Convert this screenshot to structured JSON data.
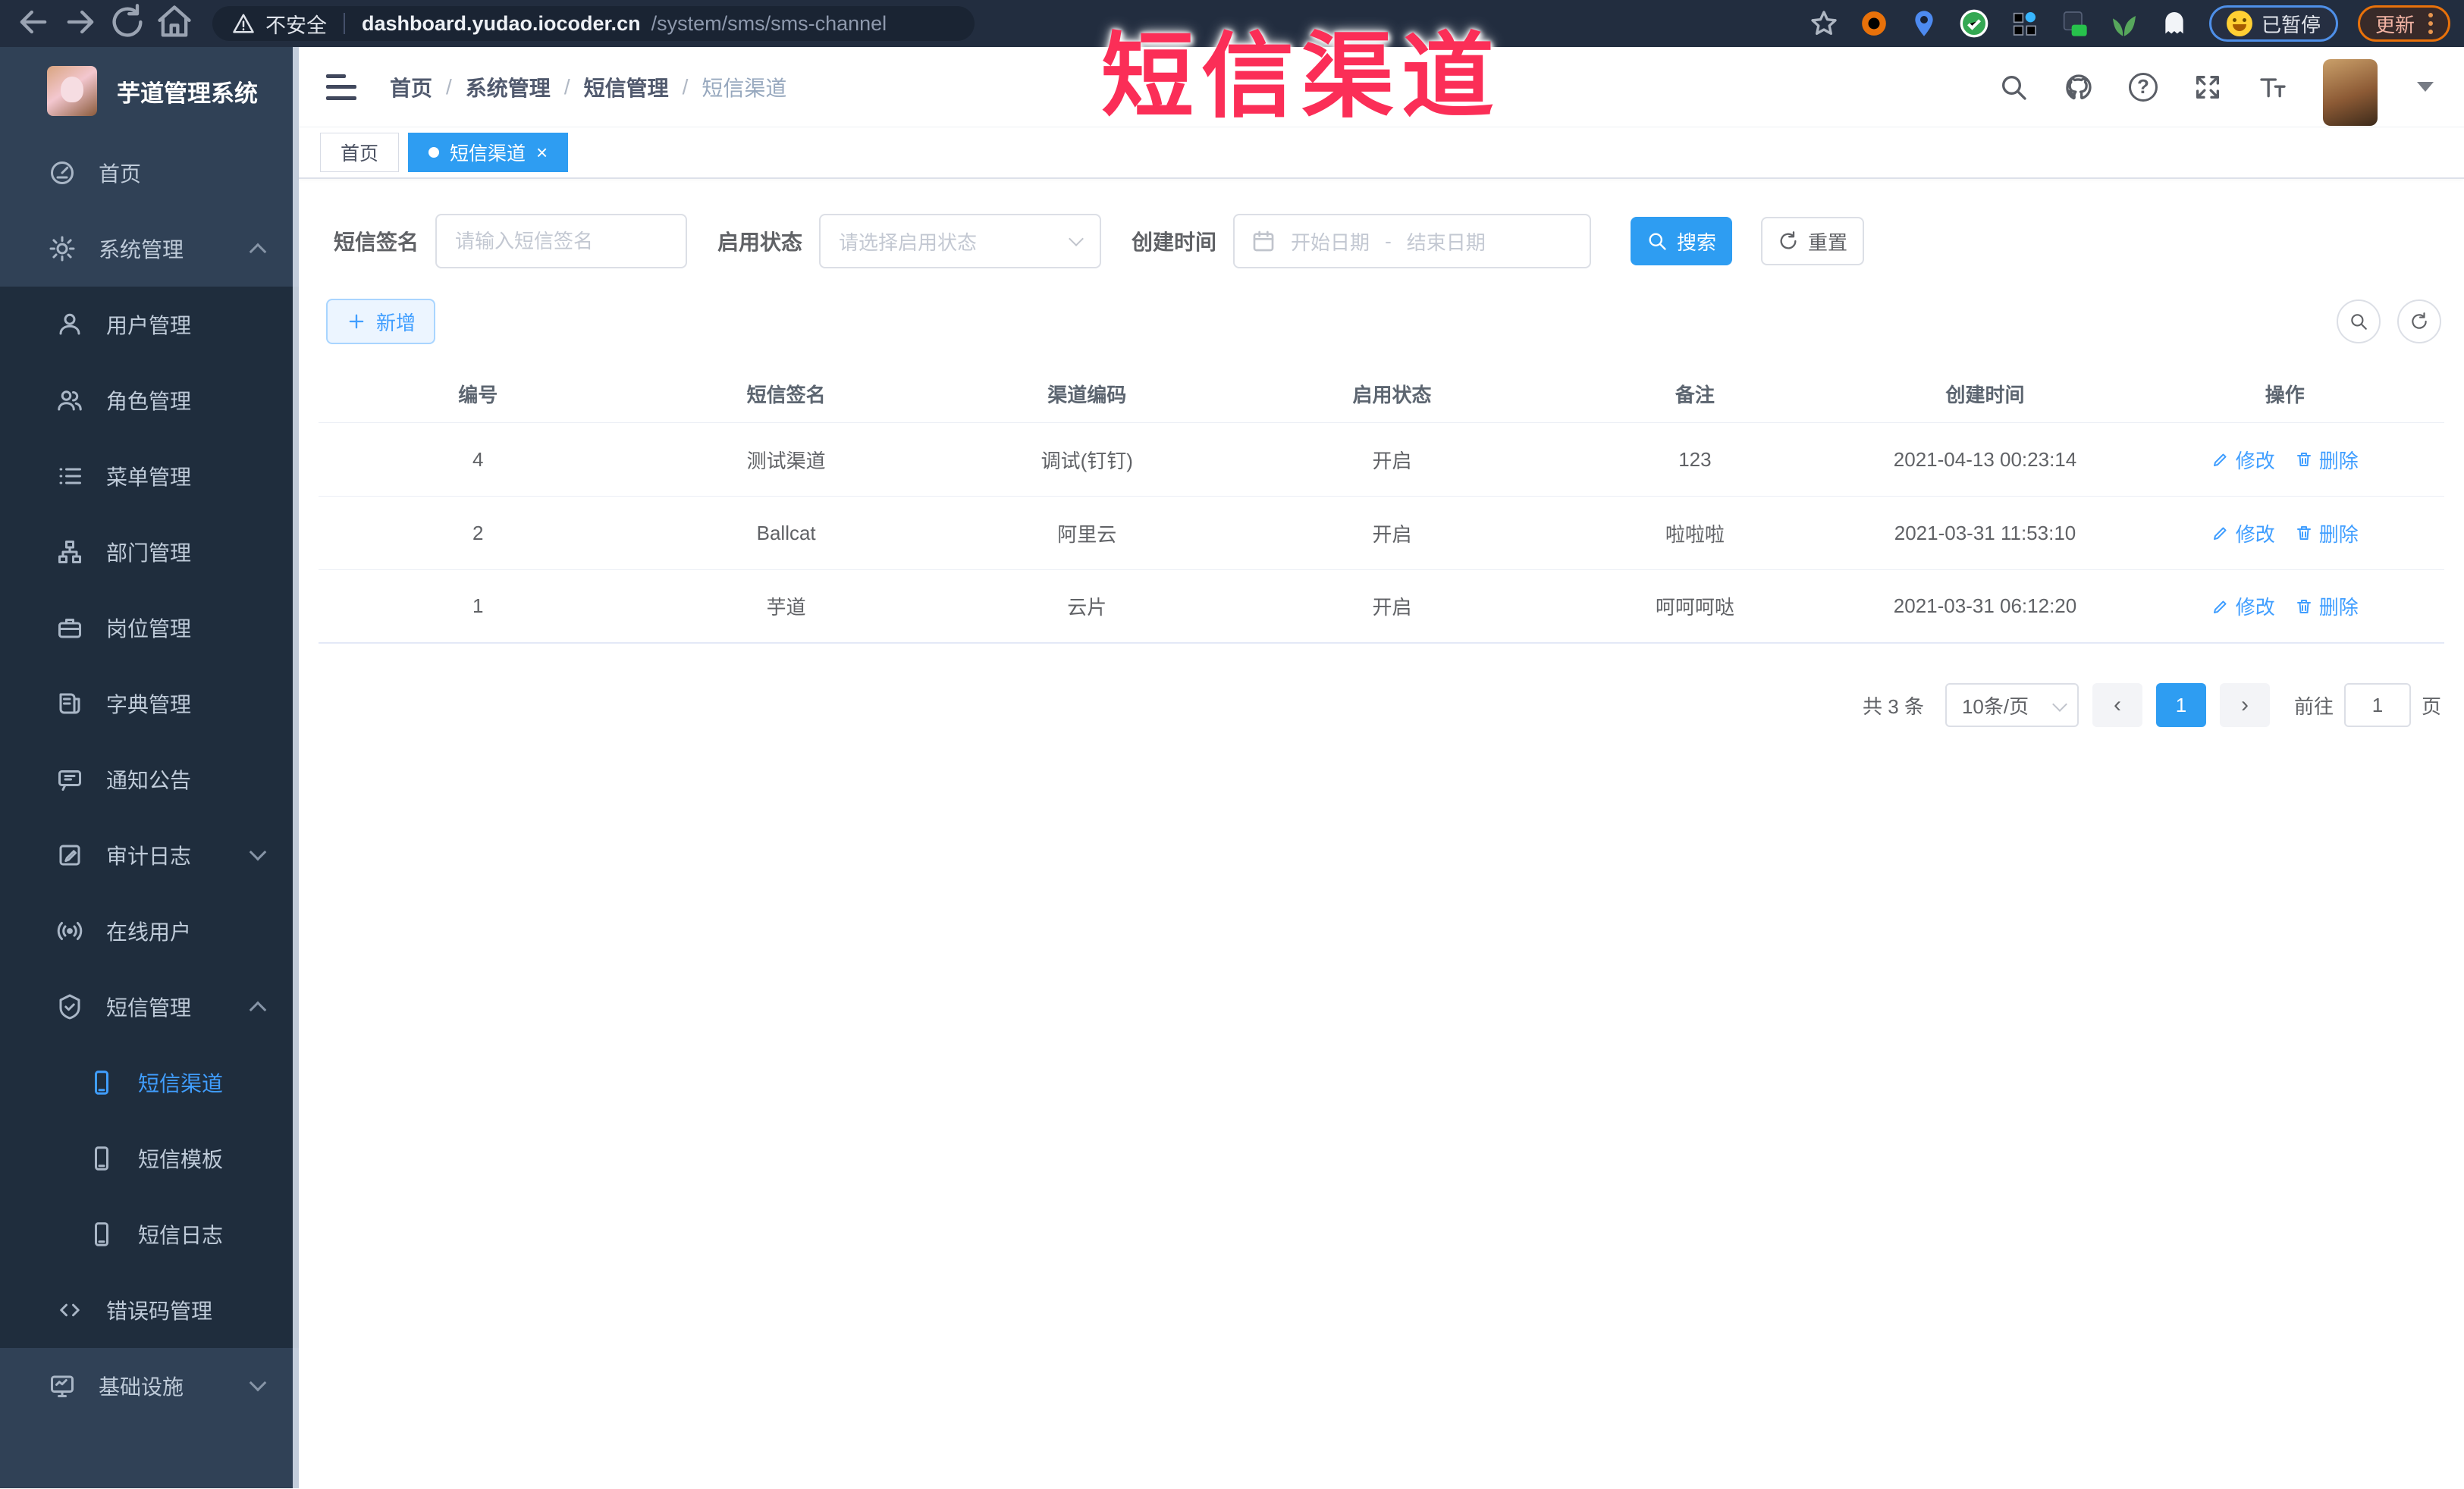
{
  "browser": {
    "not_secure_label": "不安全",
    "url_host": "dashboard.yudao.iocoder.cn",
    "url_path": "/system/sms/sms-channel",
    "paused_label": "已暂停",
    "update_label": "更新"
  },
  "overlay_title": "短信渠道",
  "sidebar": {
    "logo_title": "芋道管理系统",
    "items": [
      {
        "label": "首页"
      },
      {
        "label": "系统管理"
      },
      {
        "label": "用户管理"
      },
      {
        "label": "角色管理"
      },
      {
        "label": "菜单管理"
      },
      {
        "label": "部门管理"
      },
      {
        "label": "岗位管理"
      },
      {
        "label": "字典管理"
      },
      {
        "label": "通知公告"
      },
      {
        "label": "审计日志"
      },
      {
        "label": "在线用户"
      },
      {
        "label": "短信管理"
      },
      {
        "label": "短信渠道"
      },
      {
        "label": "短信模板"
      },
      {
        "label": "短信日志"
      },
      {
        "label": "错误码管理"
      },
      {
        "label": "基础设施"
      }
    ]
  },
  "header": {
    "breadcrumb": [
      "首页",
      "系统管理",
      "短信管理",
      "短信渠道"
    ]
  },
  "tabs": [
    {
      "label": "首页"
    },
    {
      "label": "短信渠道",
      "close": "×"
    }
  ],
  "filters": {
    "signature_label": "短信签名",
    "signature_placeholder": "请输入短信签名",
    "status_label": "启用状态",
    "status_placeholder": "请选择启用状态",
    "created_label": "创建时间",
    "date_start_placeholder": "开始日期",
    "date_separator": "-",
    "date_end_placeholder": "结束日期",
    "search_label": "搜索",
    "reset_label": "重置"
  },
  "toolbar": {
    "add_label": "新增"
  },
  "table": {
    "columns": [
      "编号",
      "短信签名",
      "渠道编码",
      "启用状态",
      "备注",
      "创建时间",
      "操作"
    ],
    "rows": [
      {
        "id": "4",
        "signature": "测试渠道",
        "code": "调试(钉钉)",
        "status": "开启",
        "remark": "123",
        "created": "2021-04-13 00:23:14"
      },
      {
        "id": "2",
        "signature": "Ballcat",
        "code": "阿里云",
        "status": "开启",
        "remark": "啦啦啦",
        "created": "2021-03-31 11:53:10"
      },
      {
        "id": "1",
        "signature": "芋道",
        "code": "云片",
        "status": "开启",
        "remark": "呵呵呵哒",
        "created": "2021-03-31 06:12:20"
      }
    ],
    "edit_label": "修改",
    "delete_label": "删除"
  },
  "pagination": {
    "total_label": "共 3 条",
    "page_size_label": "10条/页",
    "current_page": "1",
    "goto_label": "前往",
    "goto_value": "1",
    "page_unit_label": "页"
  },
  "colors": {
    "accent": "#409EFF",
    "overlay_red": "#fb2e57",
    "sidebar_bg": "#304156",
    "submenu_bg": "#1f2d3d"
  }
}
